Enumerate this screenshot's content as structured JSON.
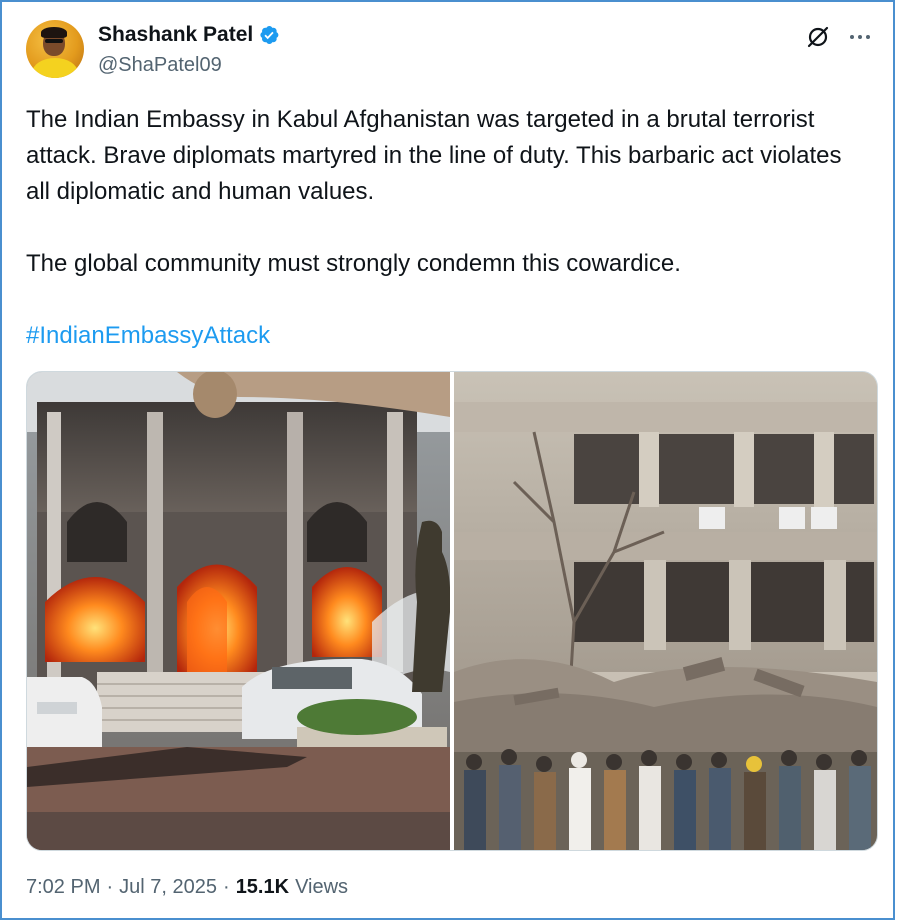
{
  "author": {
    "name": "Shashank Patel",
    "handle": "@ShaPatel09",
    "verified": true,
    "verified_color": "#1d9bf0"
  },
  "icons": {
    "grok": "grok-slash-circle-icon",
    "more": "more-horizontal-icon",
    "verified": "verified-badge-icon"
  },
  "tweet": {
    "paragraph1": "The Indian Embassy in Kabul Afghanistan was targeted in a brutal terrorist attack. Brave diplomats martyred in the line of duty. This barbaric act violates all diplomatic and human values.",
    "paragraph2": "The global community must strongly condemn this cowardice.",
    "hashtag": "#IndianEmbassyAttack",
    "hashtag_color": "#1d9bf0"
  },
  "media": {
    "images": [
      {
        "name": "burning-embassy-building-photo"
      },
      {
        "name": "bombed-building-crowd-photo"
      }
    ]
  },
  "footer": {
    "time": "7:02 PM",
    "date": "Jul 7, 2025",
    "views_count": "15.1K",
    "views_label": "Views",
    "separator": "·"
  },
  "colors": {
    "border": "#4a8fcf",
    "secondary_text": "#536471",
    "primary_text": "#0f1419"
  }
}
